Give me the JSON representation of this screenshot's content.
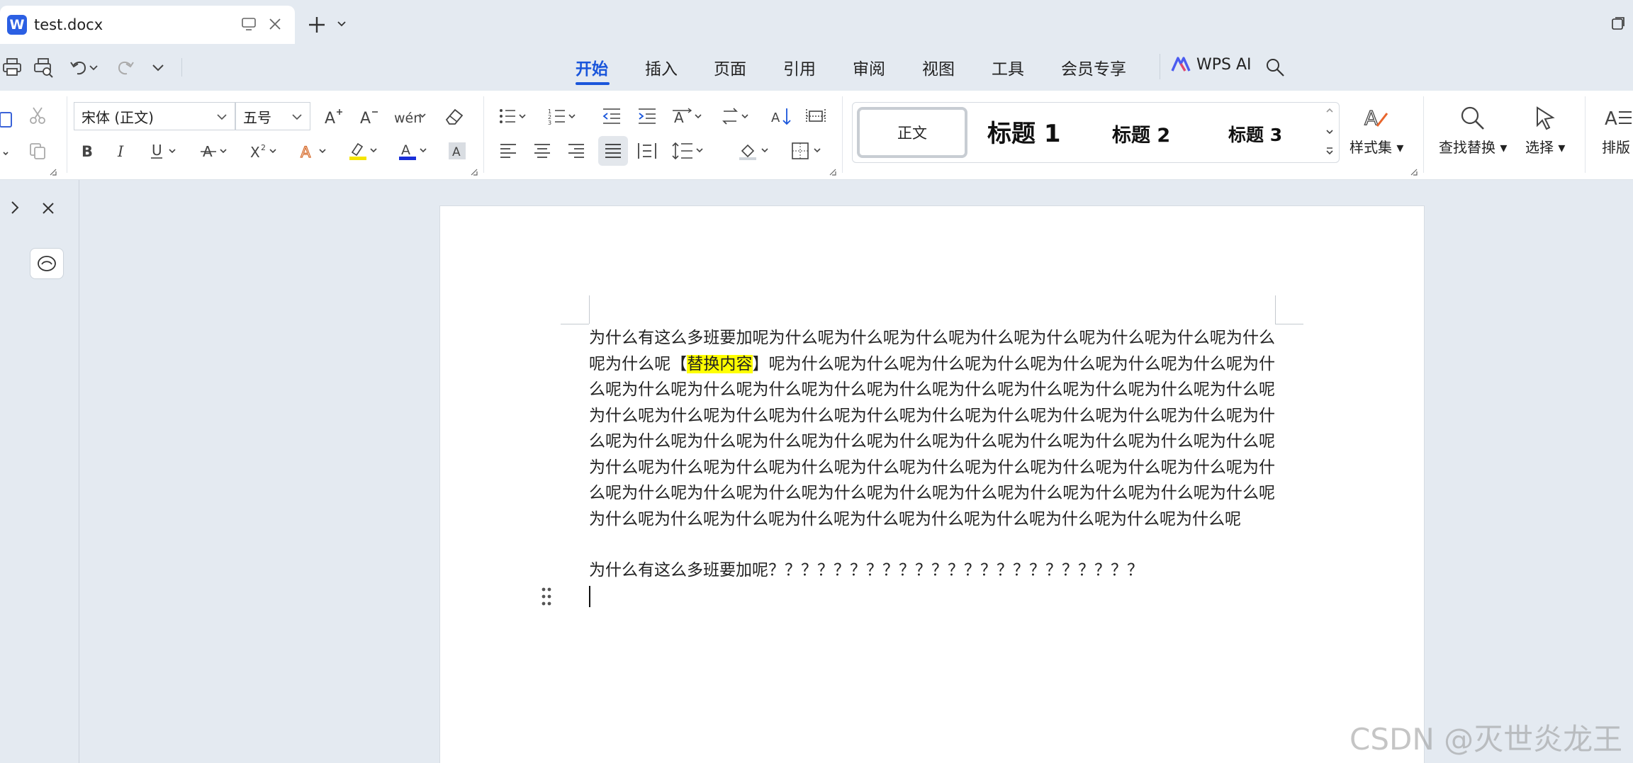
{
  "tab": {
    "app_letter": "W",
    "title": "test.docx"
  },
  "menu": {
    "items": [
      "开始",
      "插入",
      "页面",
      "引用",
      "审阅",
      "视图",
      "工具",
      "会员专享"
    ],
    "active": "开始",
    "wps_ai": "WPS AI"
  },
  "ribbon": {
    "font_name": "宋体 (正文)",
    "font_size": "五号",
    "styles": {
      "normal": "正文",
      "h1": "标题 1",
      "h2": "标题 2",
      "h3": "标题 3"
    },
    "style_set": "样式集",
    "find_replace": "查找替换",
    "select": "选择",
    "layout": "排版",
    "colors": {
      "highlight": "#f5e400",
      "font_color": "#1a2fd8",
      "accent": "#1a56db"
    }
  },
  "document": {
    "para1_before": "为什么有这么多班要加呢为什么呢为什么呢为什么呢为什么呢为什么呢为什么呢为什么呢为什么呢为什么呢",
    "para1_open_bracket": "【",
    "para1_highlight": "替换内容",
    "para1_close_bracket": "】",
    "para1_after": "呢为什么呢为什么呢为什么呢为什么呢为什么呢为什么呢为什么呢为什么呢为什么呢为什么呢为什么呢为什么呢为什么呢为什么呢为什么呢为什么呢为什么呢为什么呢为什么呢为什么呢为什么呢为什么呢为什么呢为什么呢为什么呢为什么呢为什么呢为什么呢为什么呢为什么呢为什么呢为什么呢为什么呢为什么呢为什么呢为什么呢为什么呢为什么呢为什么呢为什么呢为什么呢为什么呢为什么呢为什么呢为什么呢为什么呢为什么呢为什么呢为什么呢为什么呢为什么呢为什么呢为什么呢为什么呢为什么呢为什么呢为什么呢为什么呢为什么呢为什么呢为什么呢为什么呢为什么呢为什么呢为什么呢为什么呢为什么呢为什么呢为什么呢为什么呢",
    "para2": "为什么有这么多班要加呢？？？？？？？？？？？？？？？？？？？？？？？"
  },
  "watermark": "CSDN @灭世炎龙王"
}
